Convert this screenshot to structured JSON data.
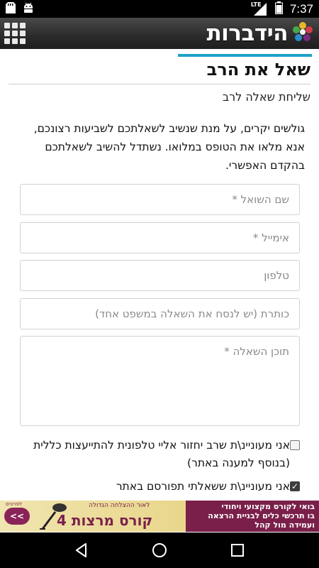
{
  "status_bar": {
    "time": "7:37",
    "network": "LTE",
    "icons": [
      "sd-card-icon",
      "android-icon",
      "signal-icon",
      "battery-icon"
    ]
  },
  "app_bar": {
    "brand": "הידברות",
    "menu_icon": "grid-menu-icon"
  },
  "page": {
    "title": "שאל את הרב",
    "subtitle": "שליחת שאלה לרב",
    "intro": "גולשים יקרים, על מנת שנשיב לשאלתכם לשביעות רצונכם, אנא מלאו את הטופס במלואו. נשתדל להשיב לשאלתכם בהקדם האפשרי."
  },
  "form": {
    "name_placeholder": "שם השואל *",
    "email_placeholder": "אימייל *",
    "phone_placeholder": "טלפון",
    "subject_placeholder": "כותרת (יש לנסח את השאלה במשפט אחד)",
    "question_placeholder": "תוכן השאלה *",
    "checkbox_callback": {
      "label": "אני מעוניינ\\ת שרב יחזור אליי טלפונית להתייעצות כללית (בנוסף למענה באתר)",
      "checked": false
    },
    "checkbox_publish": {
      "label": "אני מעוניינ\\ת ששאלתי תפורסם באתר",
      "checked": true
    }
  },
  "ad": {
    "button_label": "<<",
    "button_caption": "לפרטים",
    "title": "קורס מרצות 4",
    "tagline": "לאור ההצלחה הגדולה",
    "text_line1": "בואי לקורס מקצועי ויחודי",
    "text_line2": "בו תרכשי כלים לבניית הרצאה",
    "text_line3": "ועמידה מול קהל"
  },
  "nav_bar": {
    "back_icon": "back-icon",
    "home_icon": "home-icon",
    "recents_icon": "recents-icon"
  },
  "colors": {
    "accent": "#1ea0c8",
    "ad_purple": "#7a1f4a",
    "ad_yellow": "#e8d68a"
  }
}
